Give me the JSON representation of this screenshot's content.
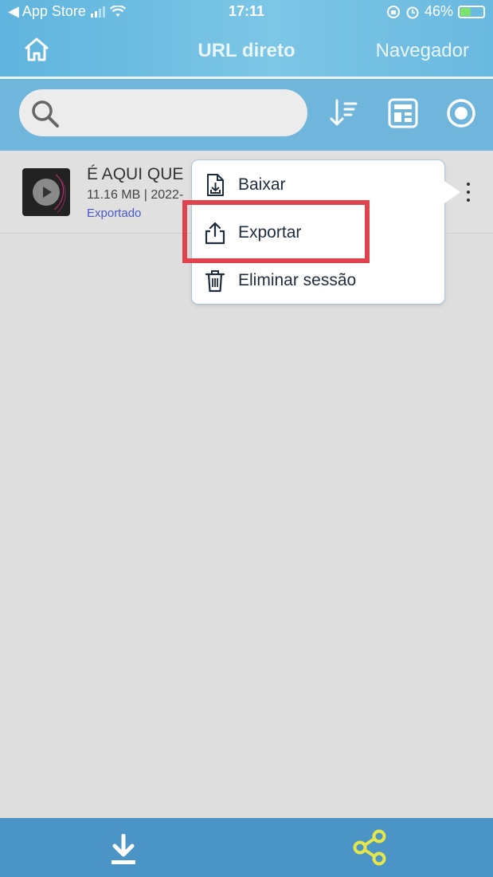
{
  "status_bar": {
    "back_label": "◀ App Store",
    "time": "17:11",
    "battery": "46%",
    "battery_level": 0.46
  },
  "nav": {
    "title": "URL direto",
    "right_label": "Navegador"
  },
  "search": {
    "placeholder": ""
  },
  "list": {
    "items": [
      {
        "title": "É AQUI QUE",
        "meta": "11.16 MB | 2022-",
        "status": "Exportado"
      }
    ]
  },
  "context_menu": {
    "items": [
      {
        "label": "Baixar",
        "icon": "download-file-icon"
      },
      {
        "label": "Exportar",
        "icon": "share-export-icon"
      },
      {
        "label": "Eliminar sessão",
        "icon": "trash-icon"
      }
    ],
    "highlighted_index": 1
  },
  "colors": {
    "header": "#6fb5dc",
    "bottom_bar": "#4a94c6",
    "highlight": "#e0424e",
    "status_text": "#4b59c7",
    "share_icon": "#e6e64a"
  }
}
